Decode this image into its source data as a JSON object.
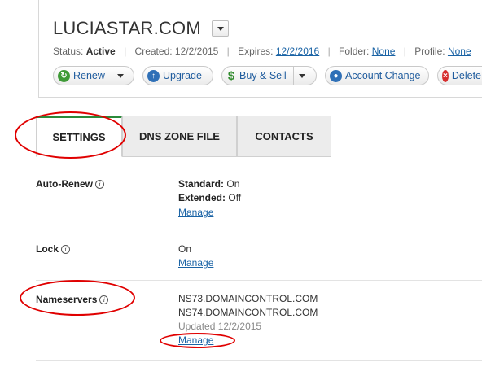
{
  "header": {
    "domain_title": "LUCIASTAR.COM",
    "status_label": "Status:",
    "status_value": "Active",
    "created_label": "Created:",
    "created_value": "12/2/2015",
    "expires_label": "Expires:",
    "expires_value": "12/2/2016",
    "folder_label": "Folder:",
    "folder_value": "None",
    "profile_label": "Profile:",
    "profile_value": "None"
  },
  "actions": {
    "renew": "Renew",
    "upgrade": "Upgrade",
    "buy_sell": "Buy & Sell",
    "account_change": "Account Change",
    "delete": "Delete"
  },
  "tabs": [
    {
      "label": "SETTINGS"
    },
    {
      "label": "DNS ZONE FILE"
    },
    {
      "label": "CONTACTS"
    }
  ],
  "settings": {
    "auto_renew": {
      "label": "Auto-Renew",
      "standard_label": "Standard:",
      "standard_value": "On",
      "extended_label": "Extended:",
      "extended_value": "Off",
      "manage": "Manage"
    },
    "lock": {
      "label": "Lock",
      "value": "On",
      "manage": "Manage"
    },
    "nameservers": {
      "label": "Nameservers",
      "ns1": "NS73.DOMAINCONTROL.COM",
      "ns2": "NS74.DOMAINCONTROL.COM",
      "updated": "Updated 12/2/2015",
      "manage": "Manage"
    }
  },
  "icons": {
    "info": "i"
  },
  "colors": {
    "link": "#1a63a5",
    "active_tab_accent": "#2a8a3a",
    "annotation": "#e00000"
  }
}
